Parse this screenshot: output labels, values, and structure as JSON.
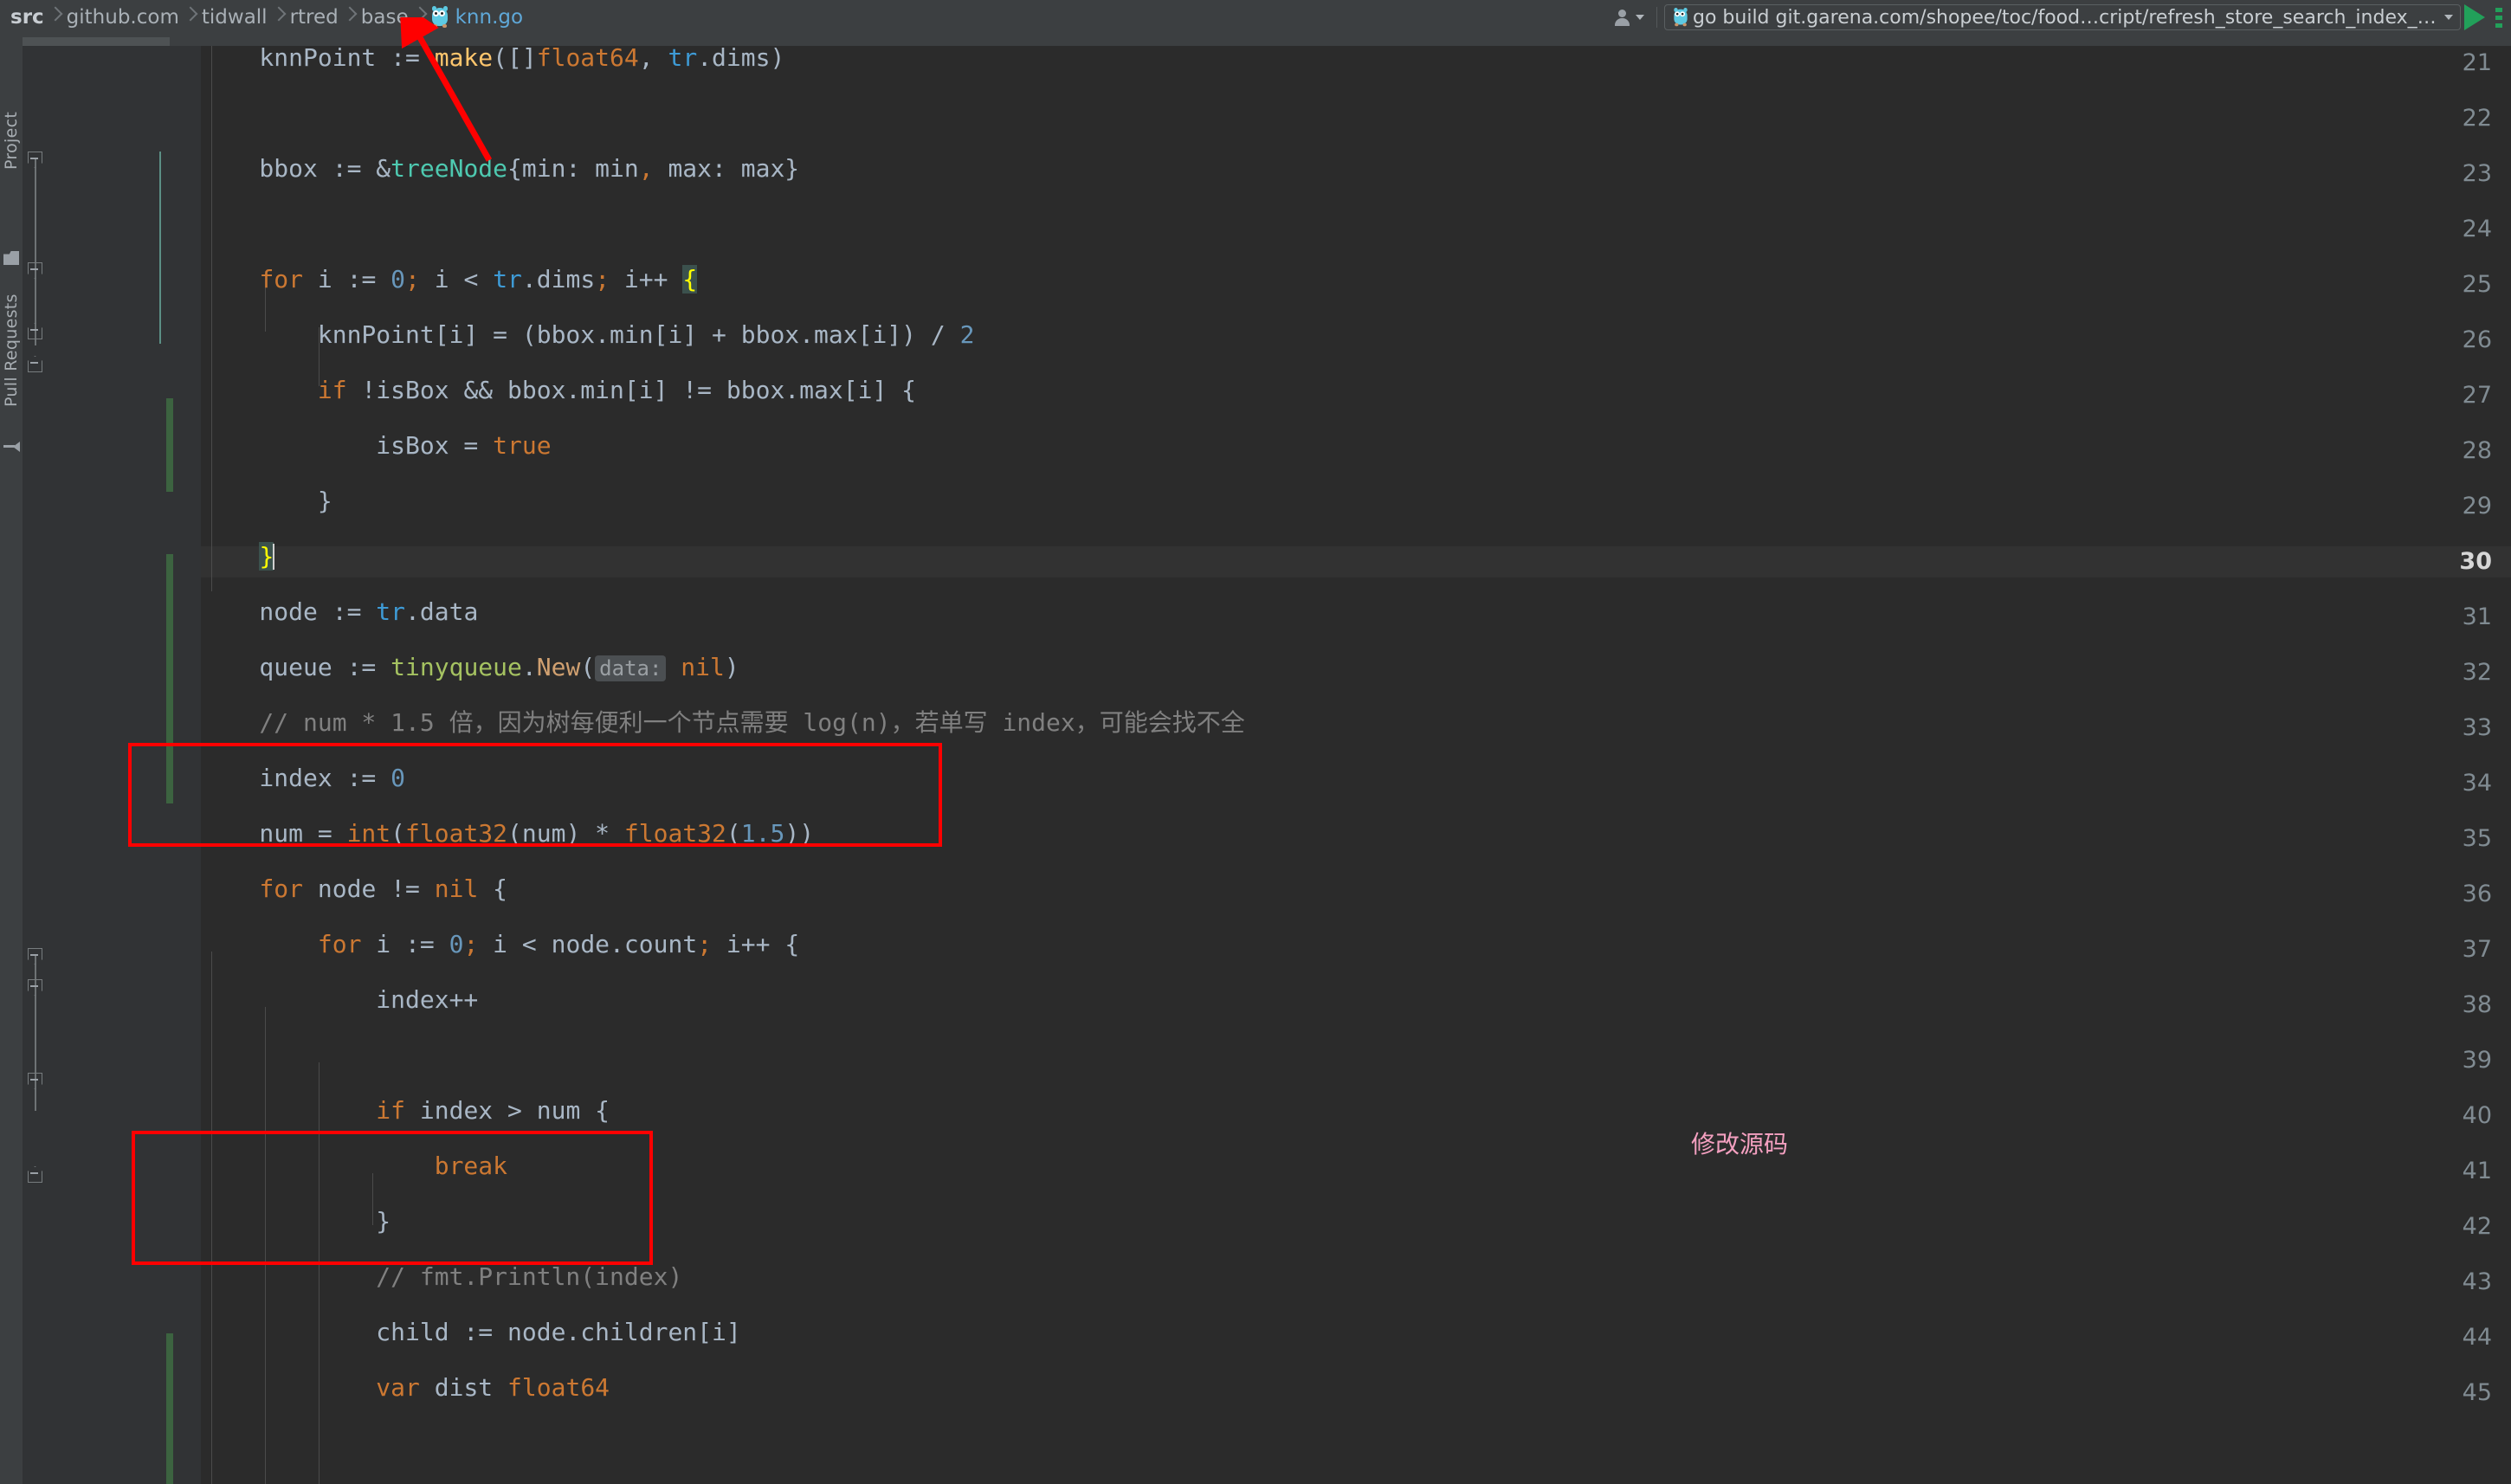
{
  "breadcrumb": {
    "items": [
      {
        "label": "src",
        "style": "bold"
      },
      {
        "label": "github.com",
        "style": "normal"
      },
      {
        "label": "tidwall",
        "style": "normal"
      },
      {
        "label": "rtred",
        "style": "normal"
      },
      {
        "label": "base",
        "style": "normal"
      },
      {
        "label": "knn.go",
        "style": "file"
      }
    ]
  },
  "toolbar": {
    "run_config_label": "go build git.garena.com/shopee/toc/food…cript/refresh_store_search_index_with_qp",
    "run_button": "Run",
    "more_button": "More",
    "user_button": "User"
  },
  "left_tools": {
    "project_label": "Project",
    "pull_requests_label": "Pull Requests"
  },
  "tab": {
    "label": "knn.go",
    "close_label": "×"
  },
  "editor": {
    "current_line": 30,
    "first_line": 21,
    "last_line": 45,
    "line_numbers": [
      21,
      22,
      23,
      24,
      25,
      26,
      27,
      28,
      29,
      30,
      31,
      32,
      33,
      34,
      35,
      36,
      37,
      38,
      39,
      40,
      41,
      42,
      43,
      44,
      45
    ],
    "lines": [
      {
        "n": 21,
        "text": "    knnPoint := make([]float64, tr.dims)"
      },
      {
        "n": 22,
        "text": ""
      },
      {
        "n": 23,
        "text": "    bbox := &treeNode{min: min, max: max}"
      },
      {
        "n": 24,
        "text": ""
      },
      {
        "n": 25,
        "text": "    for i := 0; i < tr.dims; i++ {"
      },
      {
        "n": 26,
        "text": "        knnPoint[i] = (bbox.min[i] + bbox.max[i]) / 2"
      },
      {
        "n": 27,
        "text": "        if !isBox && bbox.min[i] != bbox.max[i] {"
      },
      {
        "n": 28,
        "text": "            isBox = true"
      },
      {
        "n": 29,
        "text": "        }"
      },
      {
        "n": 30,
        "text": "    }"
      },
      {
        "n": 31,
        "text": "    node := tr.data"
      },
      {
        "n": 32,
        "text": "    queue := tinyqueue.New( data: nil)"
      },
      {
        "n": 33,
        "text": "    // num * 1.5 倍，因为树每便利一个节点需要 log(n)，若单写 index，可能会找不全"
      },
      {
        "n": 34,
        "text": "    index := 0"
      },
      {
        "n": 35,
        "text": "    num = int(float32(num) * float32(1.5))"
      },
      {
        "n": 36,
        "text": "    for node != nil {"
      },
      {
        "n": 37,
        "text": "        for i := 0; i < node.count; i++ {"
      },
      {
        "n": 38,
        "text": "            index++"
      },
      {
        "n": 39,
        "text": ""
      },
      {
        "n": 40,
        "text": "            if index > num {"
      },
      {
        "n": 41,
        "text": "                break"
      },
      {
        "n": 42,
        "text": "            }"
      },
      {
        "n": 43,
        "text": "            // fmt.Println(index)"
      },
      {
        "n": 44,
        "text": "            child := node.children[i]"
      },
      {
        "n": 45,
        "text": "            var dist float64"
      }
    ],
    "param_hint": "data:"
  },
  "annotations": {
    "note_text": "修改源码",
    "note_color": "#f4a0c0",
    "box_color": "#ff0000",
    "arrow_color": "#ff0000",
    "boxes": [
      {
        "name": "comment-and-num-scaling",
        "lines": "33-35"
      },
      {
        "name": "index-break-guard",
        "lines": "40-42"
      }
    ]
  },
  "colors": {
    "editor_bg": "#2b2b2b",
    "gutter_bg": "#313335",
    "chrome_bg": "#3c3f41",
    "tab_active_bg": "#4e5254",
    "tab_underline": "#3d86c6",
    "keyword": "#cc7832",
    "number": "#6897bb",
    "comment": "#808080",
    "text": "#a9b7c6",
    "type": "#4ec9b0",
    "package": "#a5c261",
    "function": "#ffc66d",
    "run_green": "#22a05a",
    "vcs_added": "#3c6340"
  }
}
